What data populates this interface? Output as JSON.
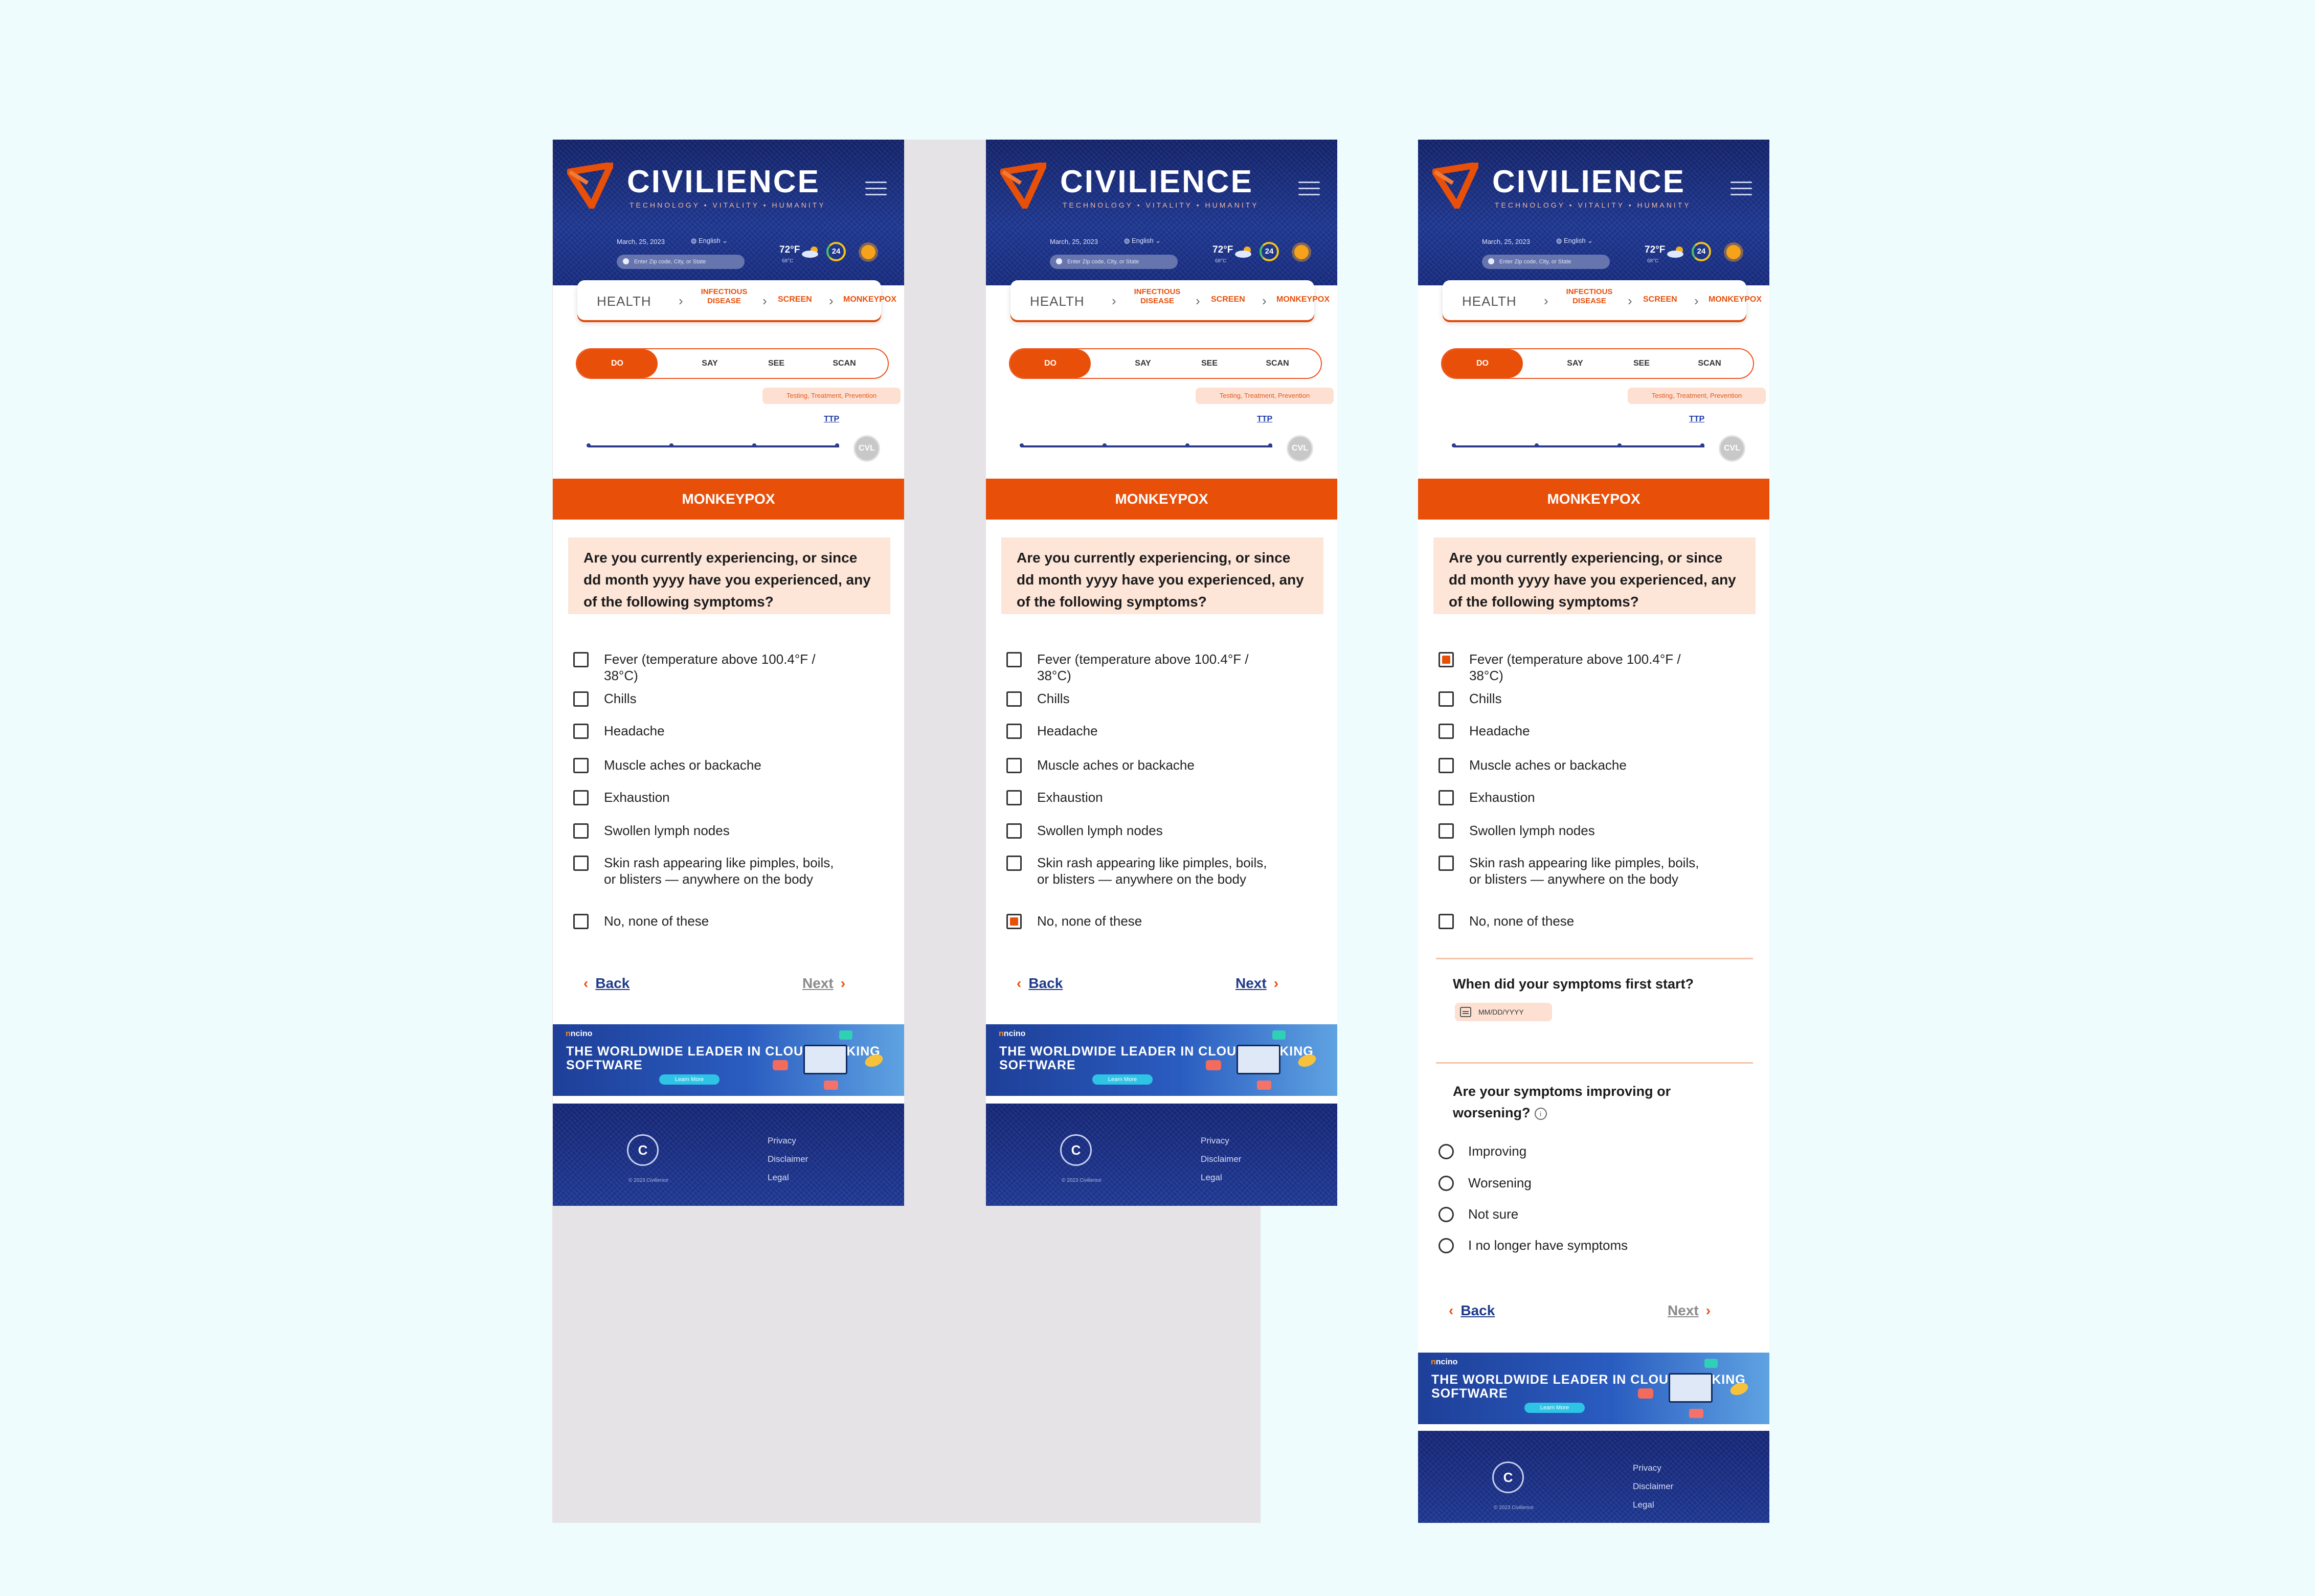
{
  "colors": {
    "accent": "#e8500a",
    "navy": "#1a2c7c",
    "link": "#1f3a8a",
    "canvas": "#effcfd"
  },
  "header": {
    "brand": "CIVILIENCE",
    "tagline": "TECHNOLOGY • VITALITY • HUMANITY",
    "date": "March, 25, 2023",
    "language": "English",
    "zip_placeholder": "Enter Zip code, City, or State",
    "temp": "72°F",
    "temp_sub": "68°C",
    "aqi": "24",
    "icons": [
      "triangle-logo-icon",
      "hamburger-menu-icon",
      "location-pin-icon",
      "globe-icon",
      "cloud-sun-icon",
      "sun-icon"
    ]
  },
  "breadcrumb": {
    "health": "HEALTH",
    "infectious": "INFECTIOUS DISEASE",
    "screen": "SCREEN",
    "current": "MONKEYPOX"
  },
  "tabs": {
    "do": "DO",
    "say": "SAY",
    "see": "SEE",
    "scan": "SCAN",
    "active": "DO",
    "hint": "Testing, Treatment, Prevention"
  },
  "ttp": "TTP",
  "cvl": "CVL",
  "section_title": "MONKEYPOX",
  "question": "Are you currently experiencing, or since dd month yyyy have you experienced, any of the following symptoms?",
  "symptoms": [
    "Fever (temperature above 100.4°F / 38°C)",
    "Chills",
    "Headache",
    "Muscle aches or backache",
    "Exhaustion",
    "Swollen lymph nodes",
    "Skin rash appearing like pimples, boils, or blisters — anywhere on the body",
    "No, none of these"
  ],
  "screens": [
    {
      "checked": []
    },
    {
      "checked": [
        7
      ]
    },
    {
      "checked": [
        0
      ]
    }
  ],
  "nav": {
    "back": "Back",
    "next": "Next"
  },
  "followup": {
    "start_question": "When did your symptoms first start?",
    "date_placeholder": "MM/DD/YYYY",
    "trend_question": "Are your symptoms improving or worsening?",
    "trend_options": [
      "Improving",
      "Worsening",
      "Not sure",
      "I no longer have symptoms"
    ]
  },
  "ad": {
    "brand_prefix": "n",
    "brand": "ncino",
    "headline": "THE WORLDWIDE LEADER IN CLOUD BANKING SOFTWARE",
    "cta": "Learn More"
  },
  "footer": {
    "logo": "C",
    "copyright": "© 2023 Civilience",
    "links": [
      "Privacy",
      "Disclaimer",
      "Legal"
    ]
  }
}
